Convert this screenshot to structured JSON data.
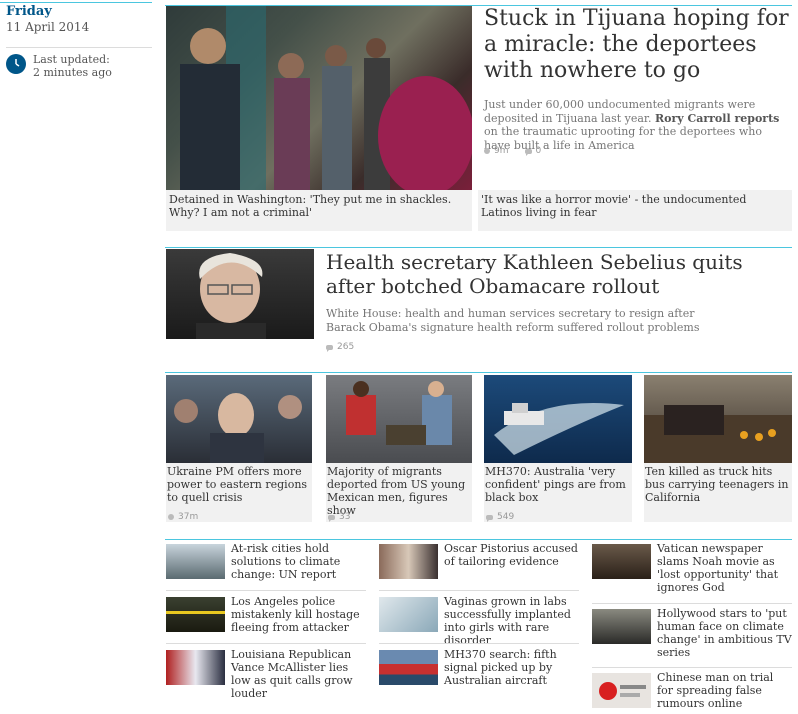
{
  "date": {
    "day": "Friday",
    "full": "11 April 2014"
  },
  "updated": {
    "label": "Last updated:",
    "value": "2 minutes ago"
  },
  "lead": {
    "headline": "Stuck in Tijuana hoping for a miracle: the deportees with nowhere to go",
    "standfirst_pre": "Just under 60,000 undocumented migrants were deposited in Tijuana last year. ",
    "standfirst_bold": "Rory Carroll reports",
    "standfirst_post": " on the traumatic uprooting for the deportees who have built a life in America",
    "time": "9m",
    "comments": "0",
    "sublinks": [
      "Detained in Washington: 'They put me in shackles. Why? I am not a criminal'",
      "'It was like a horror movie' - the undocumented Latinos living in fear"
    ]
  },
  "second": {
    "headline": "Health secretary Kathleen Sebelius quits after botched Obamacare rollout",
    "standfirst": "White House: health and human services secretary to resign after Barack Obama's signature health reform suffered rollout problems",
    "comments": "265"
  },
  "cards": [
    {
      "title": "Ukraine PM offers more power to eastern regions to quell crisis",
      "meta": "37m",
      "meta_type": "time"
    },
    {
      "title": "Majority of migrants deported from US young Mexican men, figures show",
      "meta": "33",
      "meta_type": "comments"
    },
    {
      "title": "MH370: Australia 'very confident' pings are from black box",
      "meta": "549",
      "meta_type": "comments"
    },
    {
      "title": "Ten killed as truck hits bus carrying teenagers in California",
      "meta": "",
      "meta_type": ""
    }
  ],
  "list": [
    [
      "At-risk cities hold solutions to climate change: UN report",
      "Los Angeles police mistakenly kill hostage fleeing from attacker",
      "Louisiana Republican Vance McAllister lies low as quit calls grow louder"
    ],
    [
      "Oscar Pistorius accused of tailoring evidence",
      "Vaginas grown in labs successfully implanted into girls with rare disorder",
      "MH370 search: fifth signal picked up by Australian aircraft"
    ],
    [
      "Vatican newspaper slams Noah movie as 'lost opportunity' that ignores God",
      "Hollywood stars to 'put human face on climate change' in ambitious TV series",
      "Chinese man on trial for spreading false rumours online"
    ]
  ],
  "colors": {
    "accent": "#4bc6df",
    "date_blue": "#005689",
    "caption_bg": "#f1f1f1"
  }
}
